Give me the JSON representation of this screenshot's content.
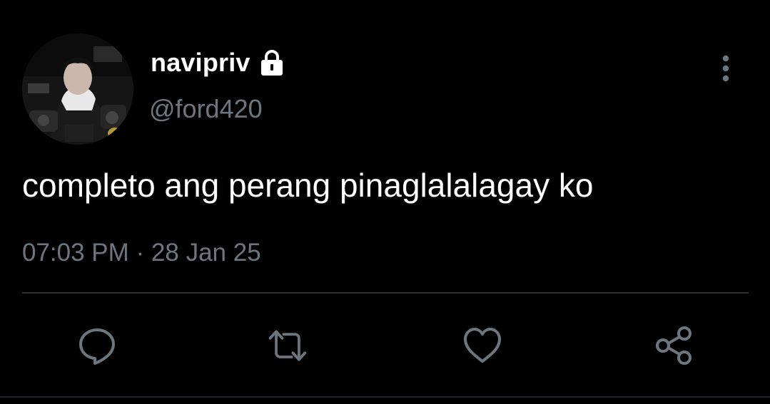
{
  "tweet": {
    "display_name": "navipriv",
    "handle": "@ford420",
    "text": "completo ang perang pinaglalalagay ko",
    "time": "07:03 PM",
    "separator": "·",
    "date": "28 Jan 25"
  },
  "icons": {
    "lock": "lock-icon",
    "more": "more-vertical-icon",
    "reply": "reply-icon",
    "retweet": "retweet-icon",
    "like": "heart-icon",
    "share": "share-icon"
  },
  "colors": {
    "background": "#000000",
    "text_primary": "#ffffff",
    "text_secondary": "#6e767d",
    "divider": "#2f3336",
    "icon": "#6e767d"
  }
}
